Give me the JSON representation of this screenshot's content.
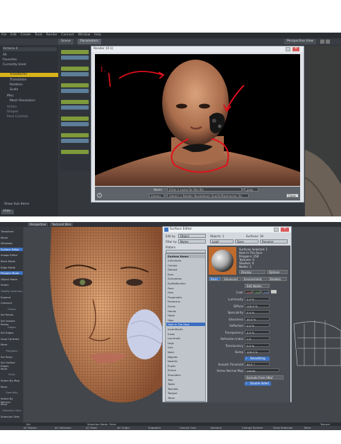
{
  "top": {
    "menu": [
      "File",
      "Edit",
      "Create",
      "Tools",
      "Render",
      "Connect",
      "Window",
      "Help"
    ],
    "tabs": [
      "Scene",
      "Parameters"
    ],
    "perspective_label": "Perspective View",
    "scene_items": [
      "Victoria 4",
      "All",
      "Favorites",
      "Currently Used",
      "Transforms",
      "Translation",
      "Rotation",
      "Scale",
      "Misc",
      "Mesh Resolution",
      "Action",
      "Shapes",
      "Pose Controls"
    ],
    "show_sub_items": "Show Sub Items",
    "hide_button": "Hide",
    "render_window": {
      "title": "Render (0:1)",
      "annotation_label": "1.",
      "name_label": "Name",
      "name_placeholder": "Enter a name for this file",
      "library_label": "Library",
      "library_path": "Library > Render_Nucleotium_Scarify/Raytracing_Vic",
      "close_button": "Close",
      "jpeg_label": "jpeg"
    }
  },
  "bottom": {
    "toolbar": {
      "view_label": "Perspective",
      "mode_label": "Textured Wire"
    },
    "tools": [
      {
        "label": "Transform"
      },
      {
        "label": "Move"
      },
      {
        "label": "Windows"
      },
      {
        "label": "Surface Editor",
        "selected": true
      },
      {
        "label": "Image Editor"
      },
      {
        "label": "Point Mode"
      },
      {
        "label": "Edge Mode"
      },
      {
        "label": "Polygon Mode",
        "selected": true
      },
      {
        "label": "Object Mode"
      },
      {
        "label": "Select"
      },
      {
        "label": "Modify Selection",
        "head": true
      },
      {
        "label": "Expand"
      },
      {
        "label": "Contract"
      },
      {
        "label": "Points",
        "head": true
      },
      {
        "label": "Sel Points"
      },
      {
        "label": "Sel Outline Points"
      },
      {
        "label": "Edges",
        "head": true
      },
      {
        "label": "Sel Edges"
      },
      {
        "label": "Loop Contract"
      },
      {
        "label": "More"
      },
      {
        "label": "Polygons",
        "head": true
      },
      {
        "label": "Sel Polys"
      },
      {
        "label": "Sel Outline Edges"
      },
      {
        "label": "More"
      },
      {
        "label": "Parts",
        "head": true
      },
      {
        "label": "Select By Map"
      },
      {
        "label": "More"
      },
      {
        "label": "Specialty",
        "head": true
      },
      {
        "label": "Select By Normal"
      },
      {
        "label": "More"
      },
      {
        "label": "Selection Sets",
        "head": true
      },
      {
        "label": "Selection Sets"
      }
    ],
    "surface_editor": {
      "title": "Surface Editor",
      "edit_by_label": "Edit by",
      "edit_by_value": "Object",
      "filter_by_label": "Filter by",
      "filter_by_value": "Name",
      "pattern_label": "Pattern",
      "objects_label": "Objects: 1",
      "surfaces_label": "Surfaces: 30",
      "load_button": "Load",
      "save_button": "Save",
      "rename_button": "Rename",
      "surface_name_header": "Surface Name",
      "surfaces": [
        "V4Victoria",
        "Cornea",
        "Default",
        "Ears",
        "EyeLashes",
        "EyeReflection",
        "Face",
        "Feet",
        "Fingernails",
        "Forearms",
        "Gums",
        "Hands",
        "Head",
        "Hips",
        "Hole In The Face",
        "InnerMouth",
        "Irises",
        "Lacrimals",
        "Legs",
        "Lips",
        "Neck",
        "Nipples",
        "Nostrils",
        "Pupils",
        "Sclera",
        "Shoulders",
        "Tear",
        "Teeth",
        "Toenails",
        "Tongue",
        "Torso"
      ],
      "selected_surface": "Hole In The Face",
      "info": [
        "Surfaces Selected: 1",
        "Hole In The Face",
        "Polygons: 258",
        "Textures: 0",
        "Shaders: 0",
        "Nodes: 2"
      ],
      "display_label": "Display",
      "options_label": "Options",
      "tabs": [
        "Basic",
        "Advanced",
        "Environment",
        "Shaders"
      ],
      "edit_nodes": "Edit Nodes",
      "color_label": "Color",
      "color_r": "200",
      "color_g": "200",
      "color_b": "200",
      "props": [
        {
          "label": "Luminosity",
          "value": "0.0 %"
        },
        {
          "label": "Diffuse",
          "value": "100.0 %"
        },
        {
          "label": "Specularity",
          "value": "0.0 %"
        },
        {
          "label": "Glossiness",
          "value": "40.0 %"
        },
        {
          "label": "Reflection",
          "value": "0.0 %"
        },
        {
          "label": "Transparency",
          "value": "0.0 %"
        },
        {
          "label": "Refraction Index",
          "value": "1.0"
        },
        {
          "label": "Translucency",
          "value": "0.0 %"
        },
        {
          "label": "Bump",
          "value": "100.0 %"
        }
      ],
      "smoothing_label": "Smoothing",
      "smooth_threshold_label": "Smooth Threshold",
      "smooth_threshold_value": "89.5 °",
      "vertex_normal_label": "Vertex Normal Map",
      "vertex_normal_value": "(none)",
      "exclude_vbuf": "Exclude From VBuf",
      "double_sided": "Double Sided",
      "comment_label": "Comment"
    },
    "status": {
      "sel_label": "Sel",
      "selection_mode": "Selection Mode:",
      "selection_mode_value": "Point",
      "texture_label": "Texture",
      "grid": "Grid",
      "bottom_items": [
        "AC Mouse",
        "AC Selection",
        "AC Point",
        "AC Origin",
        "Subpatch",
        "Cancel/ Cuts",
        "Numeric",
        "Change Surface",
        "Grow Selection",
        "More"
      ]
    }
  },
  "colors": {
    "highlight_yellow": "#d8b21a",
    "selection_blue": "#3f74c4",
    "annotation_red": "#e0101b"
  }
}
